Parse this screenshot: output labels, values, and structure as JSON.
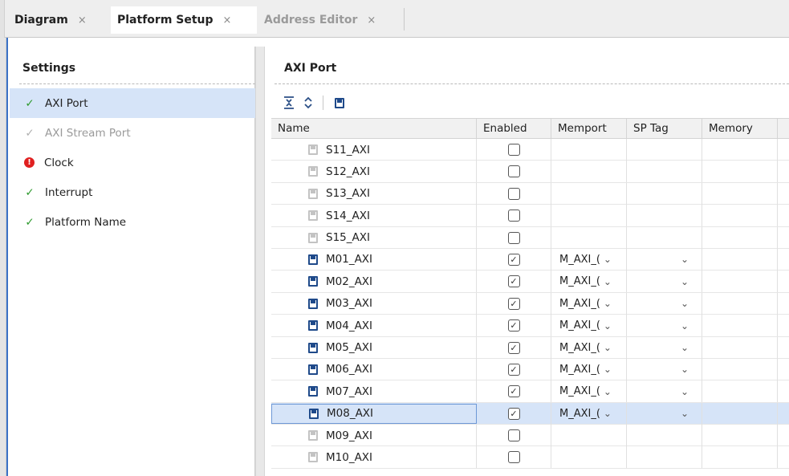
{
  "tabs": [
    {
      "label": "Diagram",
      "close": "×"
    },
    {
      "label": "Platform Setup",
      "close": "×"
    },
    {
      "label": "Address Editor",
      "close": "×"
    }
  ],
  "settings": {
    "title": "Settings",
    "items": [
      {
        "label": "AXI Port",
        "status": "ok",
        "icon": "checkmark-icon"
      },
      {
        "label": "AXI Stream Port",
        "status": "disabled",
        "icon": "checkmark-icon"
      },
      {
        "label": "Clock",
        "status": "error",
        "icon": "error-icon"
      },
      {
        "label": "Interrupt",
        "status": "ok",
        "icon": "checkmark-icon"
      },
      {
        "label": "Platform Name",
        "status": "ok",
        "icon": "checkmark-icon"
      }
    ]
  },
  "axi": {
    "title": "AXI Port",
    "columns": [
      "Name",
      "Enabled",
      "Memport",
      "SP Tag",
      "Memory"
    ],
    "rows": [
      {
        "name": "S11_AXI",
        "enabled": false,
        "memport": "",
        "sp_tag": ""
      },
      {
        "name": "S12_AXI",
        "enabled": false,
        "memport": "",
        "sp_tag": ""
      },
      {
        "name": "S13_AXI",
        "enabled": false,
        "memport": "",
        "sp_tag": ""
      },
      {
        "name": "S14_AXI",
        "enabled": false,
        "memport": "",
        "sp_tag": ""
      },
      {
        "name": "S15_AXI",
        "enabled": false,
        "memport": "",
        "sp_tag": ""
      },
      {
        "name": "M01_AXI",
        "enabled": true,
        "memport": "M_AXI_(",
        "sp_tag": ""
      },
      {
        "name": "M02_AXI",
        "enabled": true,
        "memport": "M_AXI_(",
        "sp_tag": ""
      },
      {
        "name": "M03_AXI",
        "enabled": true,
        "memport": "M_AXI_(",
        "sp_tag": ""
      },
      {
        "name": "M04_AXI",
        "enabled": true,
        "memport": "M_AXI_(",
        "sp_tag": ""
      },
      {
        "name": "M05_AXI",
        "enabled": true,
        "memport": "M_AXI_(",
        "sp_tag": ""
      },
      {
        "name": "M06_AXI",
        "enabled": true,
        "memport": "M_AXI_(",
        "sp_tag": ""
      },
      {
        "name": "M07_AXI",
        "enabled": true,
        "memport": "M_AXI_(",
        "sp_tag": ""
      },
      {
        "name": "M08_AXI",
        "enabled": true,
        "memport": "M_AXI_(",
        "sp_tag": "",
        "selected": true
      },
      {
        "name": "M09_AXI",
        "enabled": false,
        "memport": "",
        "sp_tag": ""
      },
      {
        "name": "M10_AXI",
        "enabled": false,
        "memport": "",
        "sp_tag": ""
      }
    ]
  },
  "colors": {
    "selection": "#d6e4f8",
    "ok": "#2e9a2e",
    "error": "#e02020",
    "accent": "#3b72c7"
  }
}
